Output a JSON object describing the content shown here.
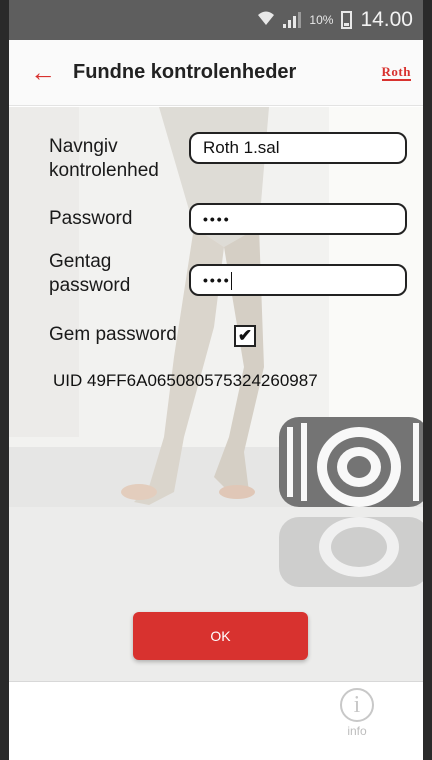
{
  "status_bar": {
    "battery": "10%",
    "time": "14.00"
  },
  "app_bar": {
    "title": "Fundne kontrolenheder",
    "brand": "Roth"
  },
  "form": {
    "name_label_line1": "Navngiv",
    "name_label_line2": "kontrolenhed",
    "name_value": "Roth 1.sal",
    "password_label": "Password",
    "password_value": "••••",
    "repeat_label_line1": "Gentag",
    "repeat_label_line2": "password",
    "repeat_value": "••••",
    "save_label": "Gem password",
    "save_checked": true,
    "save_mark": "✔",
    "uid": "UID 49FF6A065080575324260987"
  },
  "actions": {
    "ok_label": "OK"
  },
  "footer": {
    "info_glyph": "i",
    "info_label": "info"
  },
  "colors": {
    "accent": "#d8322f",
    "status_bar": "#5e5e5e"
  }
}
